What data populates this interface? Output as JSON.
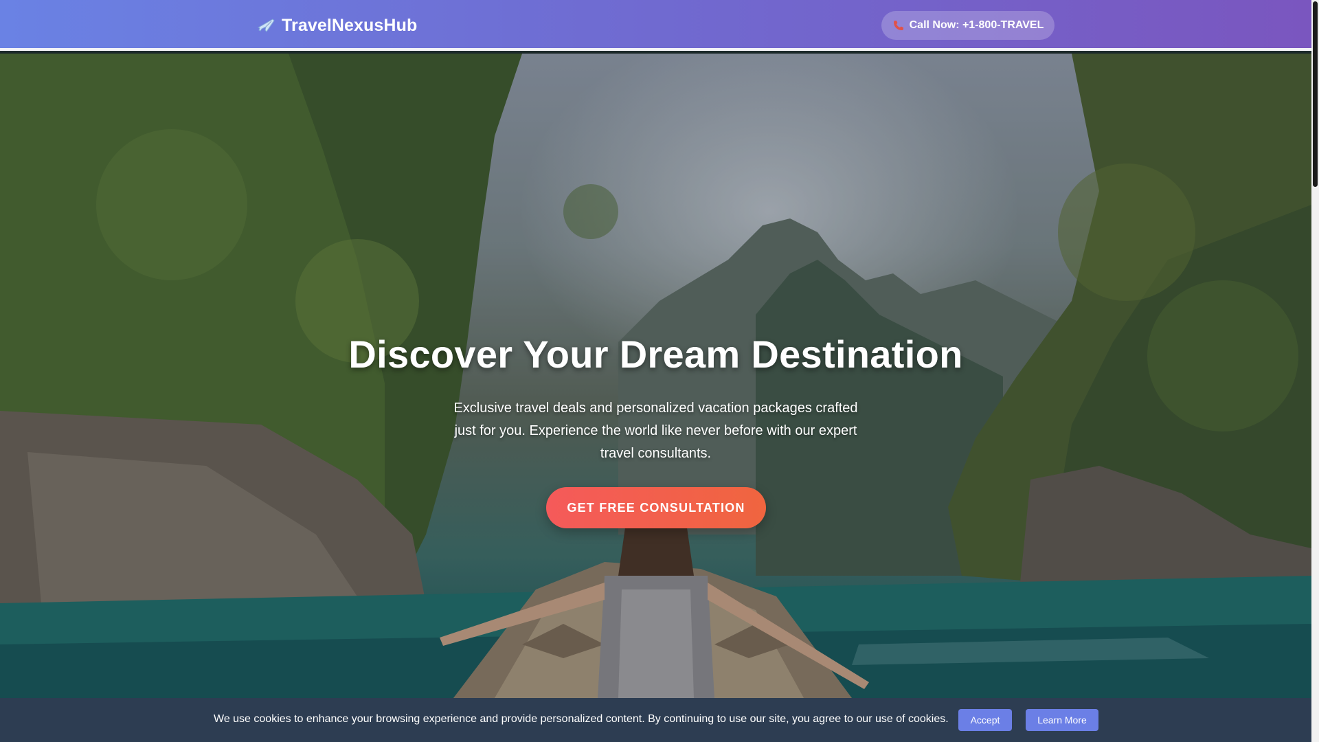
{
  "header": {
    "brand_icon": "airplane-icon",
    "brand_name": "TravelNexusHub",
    "call_icon": "phone-icon",
    "call_label": "Call Now: +1-800-TRAVEL",
    "gradient_colors": [
      "#6a82e4",
      "#7a56bf"
    ]
  },
  "hero": {
    "title": "Discover Your Dream Destination",
    "subtitle": "Exclusive travel deals and personalized vacation packages crafted just for you. Experience the world like never before with our expert travel consultants.",
    "cta_label": "GET FREE CONSULTATION",
    "cta_color": "#f55a5a"
  },
  "cookie_banner": {
    "text": "We use cookies to enhance your browsing experience and provide personalized content. By continuing to use our site, you agree to our use of cookies.",
    "accept_label": "Accept",
    "learn_more_label": "Learn More",
    "button_color": "#6b7fe6",
    "background_color": "#2d3d52"
  }
}
